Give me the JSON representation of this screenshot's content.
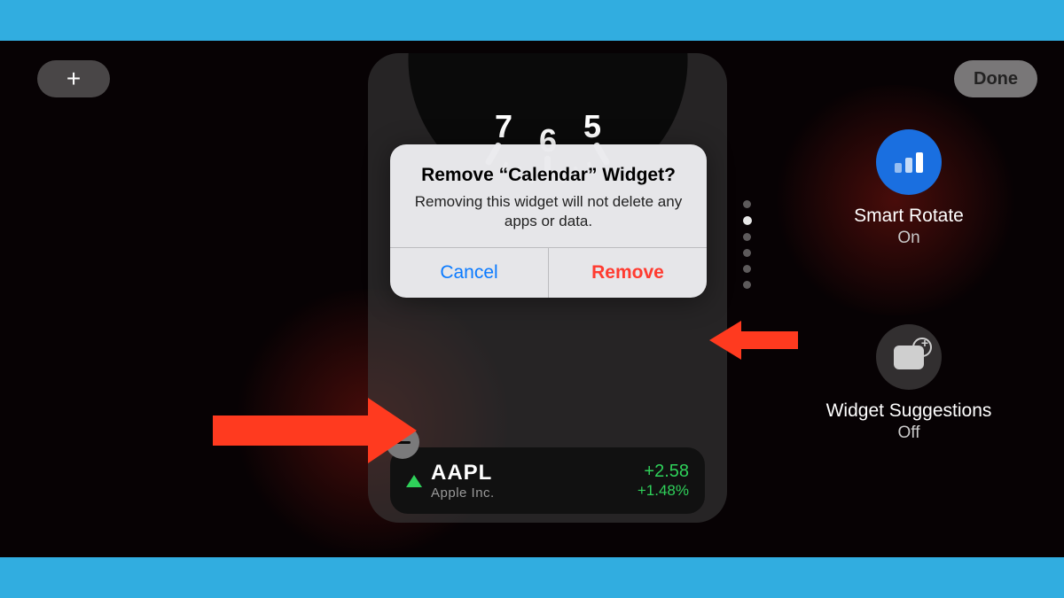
{
  "toolbar": {
    "add": "+",
    "done": "Done"
  },
  "clock": {
    "numerals": [
      "7",
      "6",
      "5"
    ]
  },
  "stock": {
    "symbol": "AAPL",
    "company": "Apple Inc.",
    "change": "+2.58",
    "percent": "+1.48%"
  },
  "smart_rotate": {
    "title": "Smart Rotate",
    "state": "On"
  },
  "widget_suggestions": {
    "title": "Widget Suggestions",
    "state": "Off"
  },
  "alert": {
    "title": "Remove “Calendar” Widget?",
    "message": "Removing this widget will not delete any apps or data.",
    "cancel": "Cancel",
    "remove": "Remove"
  }
}
